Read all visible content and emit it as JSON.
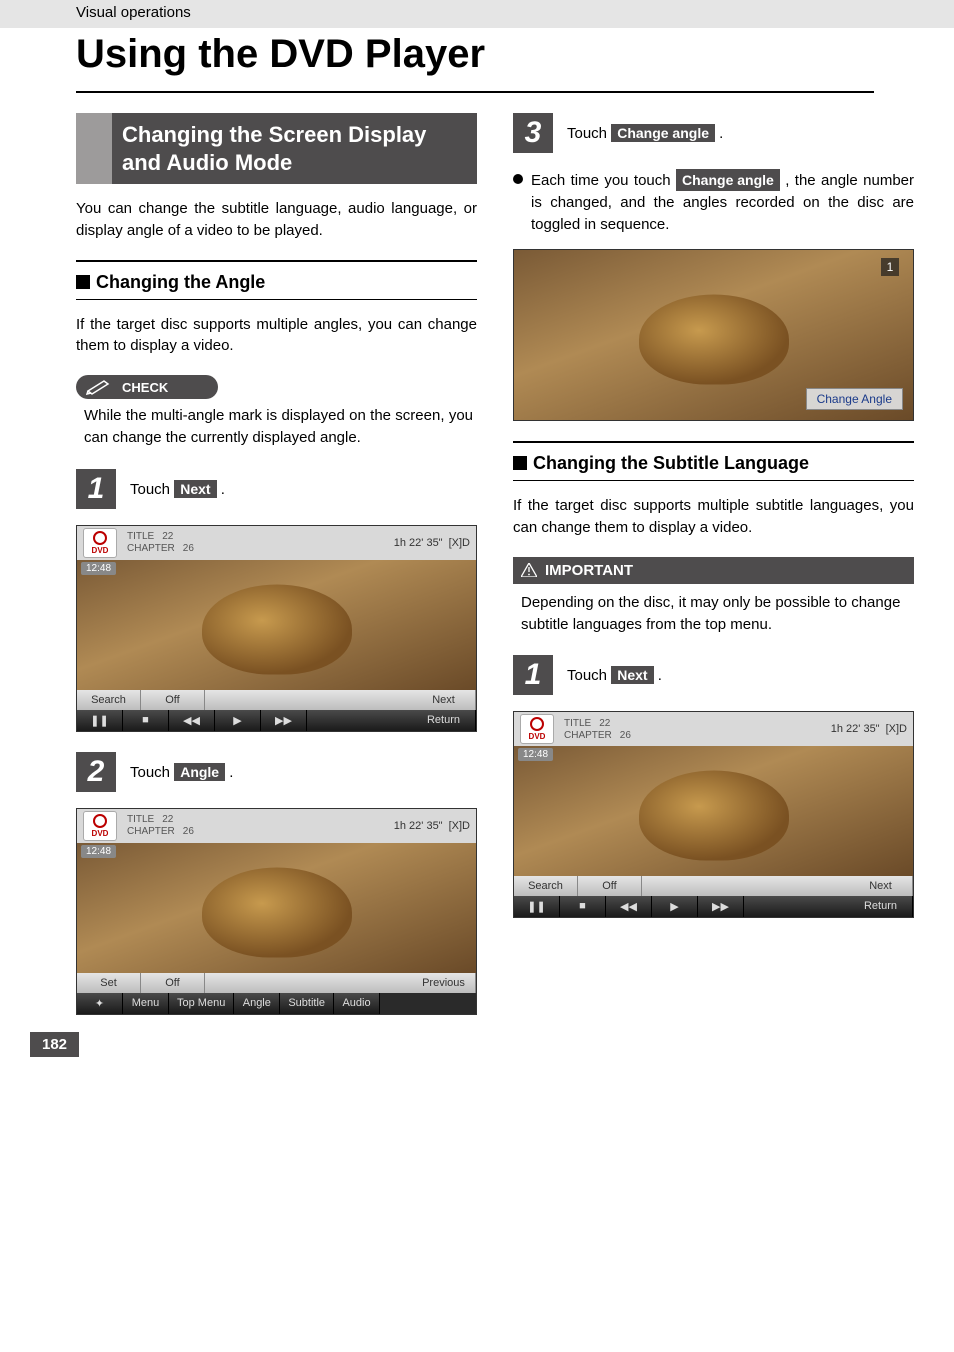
{
  "header": {
    "category": "Visual operations",
    "title": "Using the DVD Player"
  },
  "page_number": "182",
  "left": {
    "section_title": "Changing the Screen Display and Audio Mode",
    "intro": "You can change the subtitle language, audio language, or display angle of a video to be played.",
    "sub1_title": "Changing the Angle",
    "sub1_body": "If the target disc supports multiple angles, you can change them to display a video.",
    "check_label": "CHECK",
    "check_body": "While the multi-angle mark is displayed on the screen, you can change the currently displayed angle.",
    "step1_num": "1",
    "step1_pre": "Touch ",
    "step1_btn": "Next",
    "step1_post": " .",
    "step2_num": "2",
    "step2_pre": "Touch ",
    "step2_btn": "Angle",
    "step2_post": " .",
    "shot_a": {
      "title_lbl": "TITLE",
      "title_val": "22",
      "chapter_lbl": "CHAPTER",
      "chapter_val": "26",
      "runtime": "1h 22' 35\"",
      "dolby": "[X]D",
      "clock": "12:48",
      "dvd": "DVD",
      "row1": [
        "Search",
        "Off"
      ],
      "row1_right": "Next",
      "row2": [
        "❚❚",
        "■",
        "◀◀",
        "▶",
        "▶▶",
        "Return"
      ]
    },
    "shot_b": {
      "title_lbl": "TITLE",
      "title_val": "22",
      "chapter_lbl": "CHAPTER",
      "chapter_val": "26",
      "runtime": "1h 22' 35\"",
      "dolby": "[X]D",
      "clock": "12:48",
      "dvd": "DVD",
      "row1": [
        "Set",
        "Off"
      ],
      "row1_right": "Previous",
      "row2": [
        "✦",
        "Menu",
        "Top Menu",
        "Angle",
        "Subtitle",
        "Audio"
      ]
    }
  },
  "right": {
    "step3_num": "3",
    "step3_pre": "Touch ",
    "step3_btn": "Change angle",
    "step3_post": " .",
    "bullet_pre": "Each time you touch ",
    "bullet_btn": "Change angle",
    "bullet_post": " , the angle number is changed, and the angles recorded on the disc are toggled in sequence.",
    "overlay_btn": "Change Angle",
    "overlay_num": "1",
    "sub2_title": "Changing the Subtitle Language",
    "sub2_body": "If the target disc supports multiple subtitle languages, you can change them to display a video.",
    "important_label": "IMPORTANT",
    "important_body": "Depending on the disc, it may only be possible to change subtitle languages from the top menu.",
    "step1_num": "1",
    "step1_pre": "Touch ",
    "step1_btn": "Next",
    "step1_post": " .",
    "shot_c": {
      "title_lbl": "TITLE",
      "title_val": "22",
      "chapter_lbl": "CHAPTER",
      "chapter_val": "26",
      "runtime": "1h 22' 35\"",
      "dolby": "[X]D",
      "clock": "12:48",
      "dvd": "DVD",
      "row1": [
        "Search",
        "Off"
      ],
      "row1_right": "Next",
      "row2": [
        "❚❚",
        "■",
        "◀◀",
        "▶",
        "▶▶",
        "Return"
      ]
    }
  }
}
